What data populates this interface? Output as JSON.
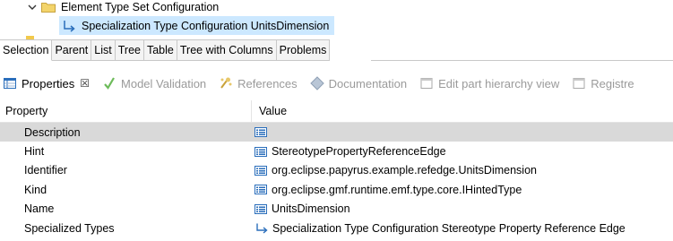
{
  "tree": {
    "root_label": "Element Type Set Configuration",
    "child_label": "Specialization Type Configuration UnitsDimension"
  },
  "subtabs": [
    "Selection",
    "Parent",
    "List",
    "Tree",
    "Table",
    "Tree with Columns",
    "Problems"
  ],
  "views": {
    "properties": "Properties",
    "close": "☒",
    "model_validation": "Model Validation",
    "references": "References",
    "documentation": "Documentation",
    "edit_part_hierarchy": "Edit part hierarchy view",
    "registry": "Registre"
  },
  "table": {
    "col_property": "Property",
    "col_value": "Value",
    "rows": [
      {
        "property": "Description",
        "value": ""
      },
      {
        "property": "Hint",
        "value": "StereotypePropertyReferenceEdge"
      },
      {
        "property": "Identifier",
        "value": "org.eclipse.papyrus.example.refedge.UnitsDimension"
      },
      {
        "property": "Kind",
        "value": "org.eclipse.gmf.runtime.emf.type.core.IHintedType"
      },
      {
        "property": "Name",
        "value": "UnitsDimension"
      },
      {
        "property": "Specialized Types",
        "value": "Specialization Type Configuration Stereotype Property Reference Edge"
      }
    ]
  },
  "colors": {
    "selection_tree": "#cce8ff",
    "selection_row": "#d9d9d9",
    "icon_blue": "#2a6ebb",
    "disabled_text": "#9a9a9a"
  }
}
